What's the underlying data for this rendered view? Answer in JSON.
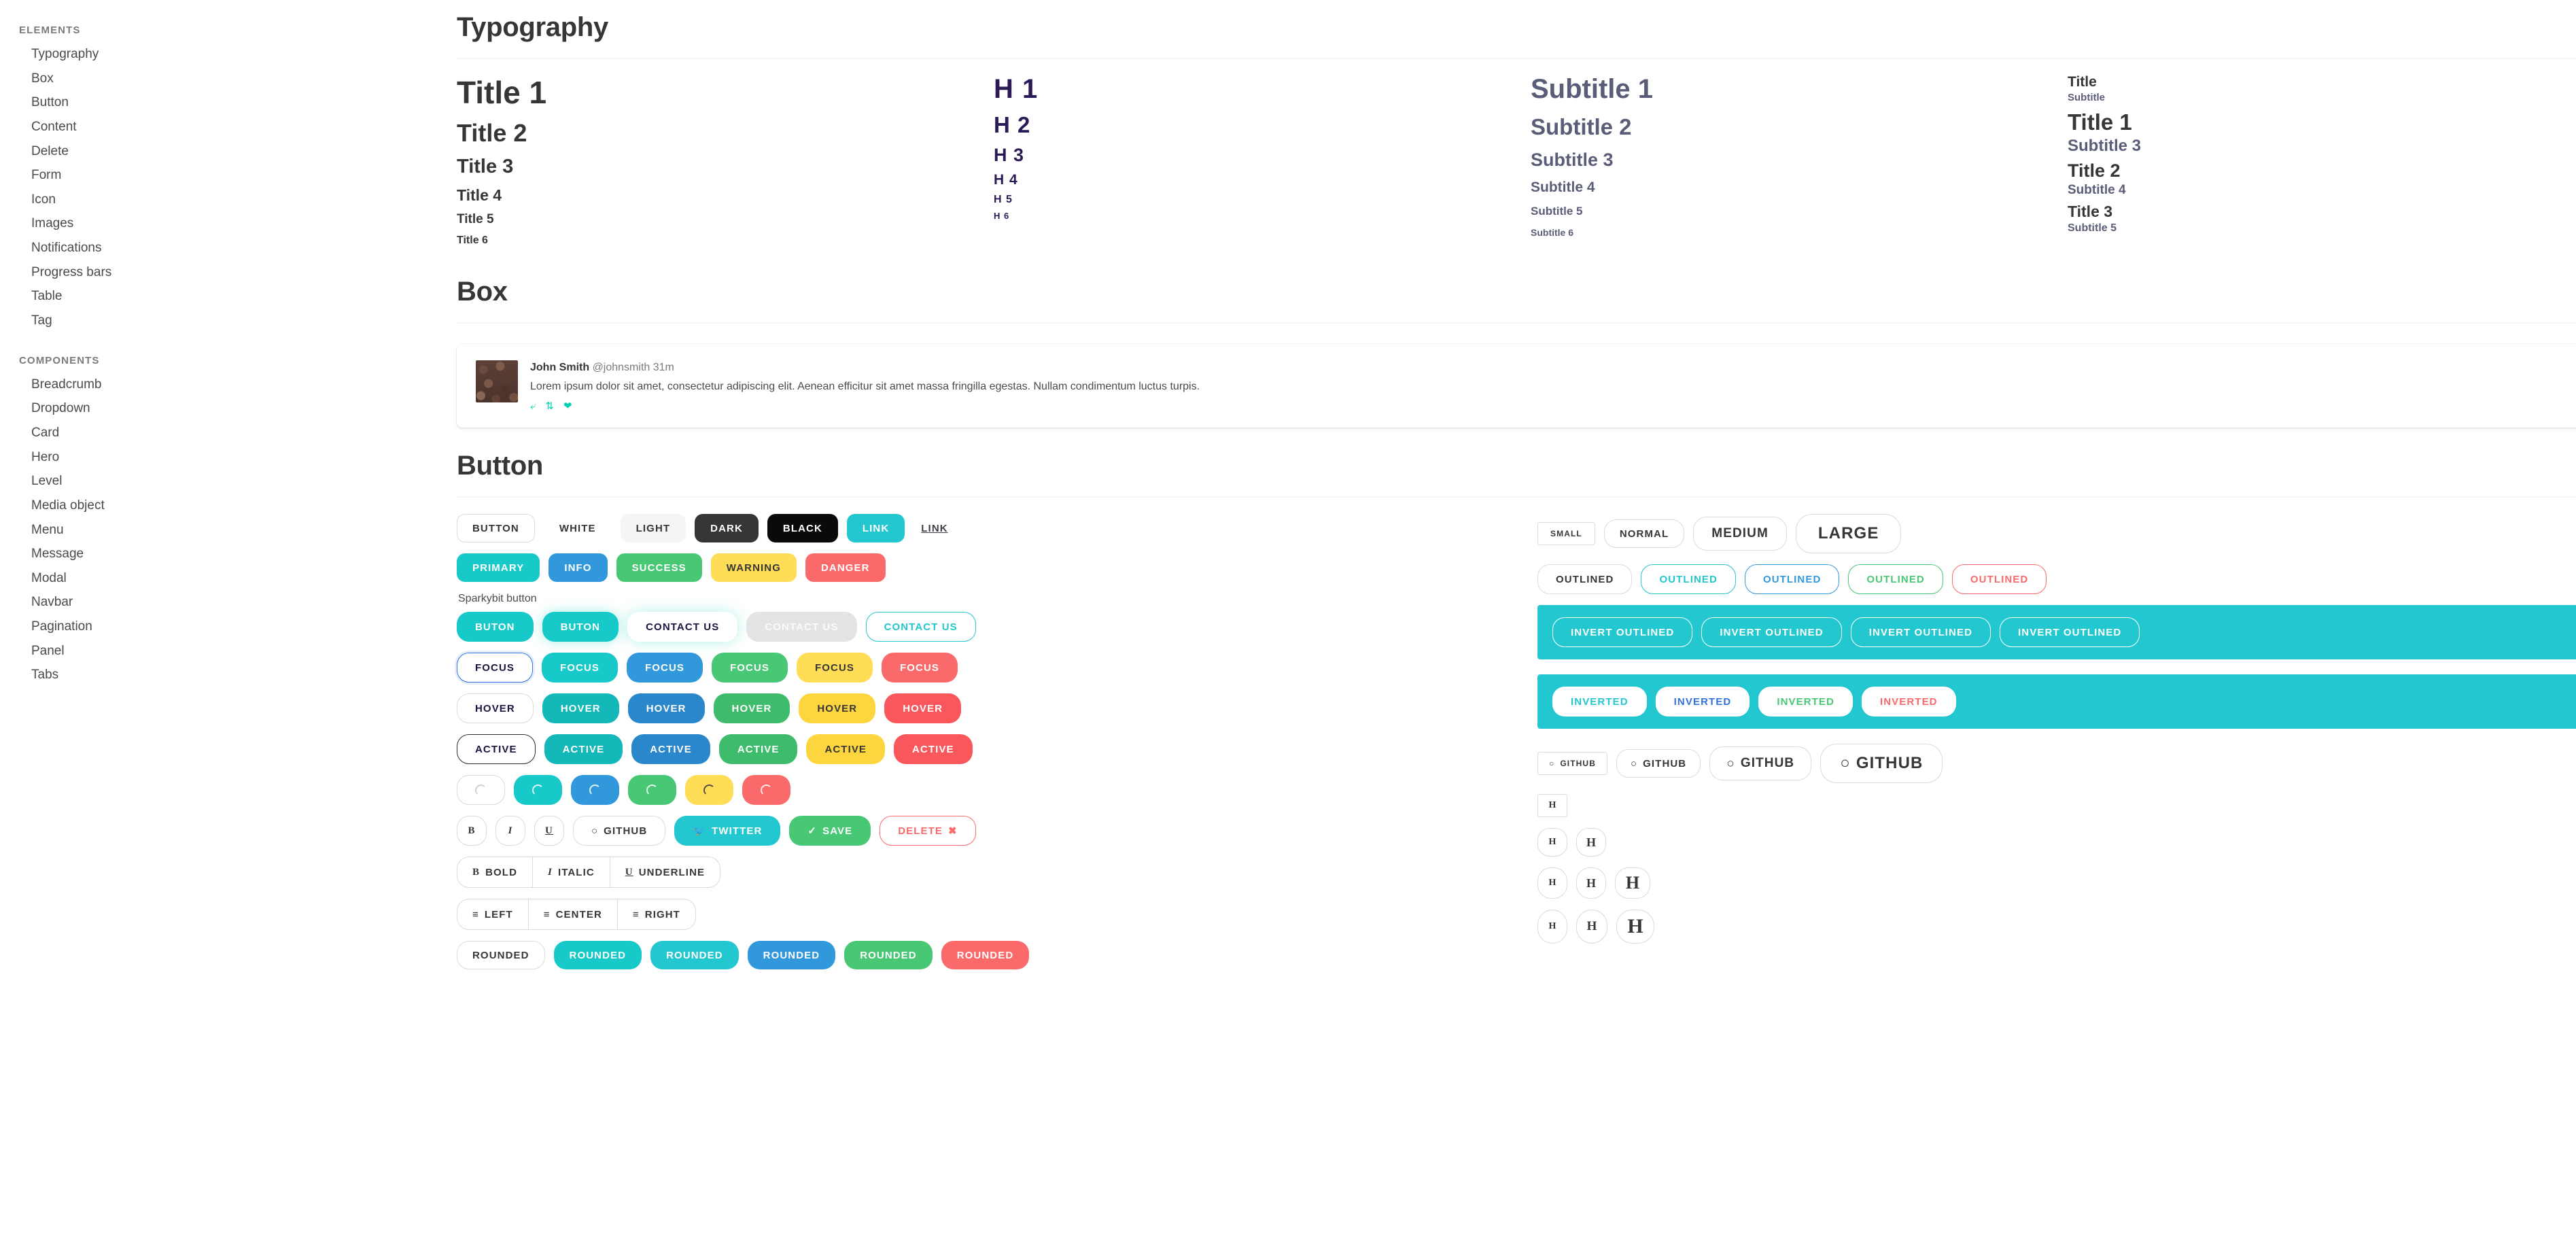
{
  "sidebar": {
    "elements_label": "ELEMENTS",
    "components_label": "COMPONENTS",
    "elements": [
      {
        "label": "Typography"
      },
      {
        "label": "Box"
      },
      {
        "label": "Button"
      },
      {
        "label": "Content"
      },
      {
        "label": "Delete"
      },
      {
        "label": "Form"
      },
      {
        "label": "Icon"
      },
      {
        "label": "Images"
      },
      {
        "label": "Notifications"
      },
      {
        "label": "Progress bars"
      },
      {
        "label": "Table"
      },
      {
        "label": "Tag"
      }
    ],
    "components": [
      {
        "label": "Breadcrumb"
      },
      {
        "label": "Dropdown"
      },
      {
        "label": "Card"
      },
      {
        "label": "Hero"
      },
      {
        "label": "Level"
      },
      {
        "label": "Media object"
      },
      {
        "label": "Menu"
      },
      {
        "label": "Message"
      },
      {
        "label": "Modal"
      },
      {
        "label": "Navbar"
      },
      {
        "label": "Pagination"
      },
      {
        "label": "Panel"
      },
      {
        "label": "Tabs"
      }
    ]
  },
  "typography": {
    "heading": "Typography",
    "titles": [
      "Title 1",
      "Title 2",
      "Title 3",
      "Title 4",
      "Title 5",
      "Title 6"
    ],
    "headings": [
      "H 1",
      "H 2",
      "H 3",
      "H 4",
      "H 5",
      "H 6"
    ],
    "subtitles": [
      "Subtitle 1",
      "Subtitle 2",
      "Subtitle 3",
      "Subtitle 4",
      "Subtitle 5",
      "Subtitle 6"
    ],
    "mixed": [
      {
        "title": "Title",
        "subtitle": "Subtitle"
      },
      {
        "title": "Title 1",
        "subtitle": "Subtitle 3"
      },
      {
        "title": "Title 2",
        "subtitle": "Subtitle 4"
      },
      {
        "title": "Title 3",
        "subtitle": "Subtitle 5"
      }
    ],
    "colors": {
      "title": "#363636",
      "heading": "#2b1a55",
      "subtitle": "#5a5d78"
    }
  },
  "box": {
    "heading": "Box",
    "author": "John Smith",
    "meta": "@johnsmith 31m",
    "text": "Lorem ipsum dolor sit amet, consectetur adipiscing elit. Aenean efficitur sit amet massa fringilla egestas. Nullam condimentum luctus turpis.",
    "actions": [
      "reply-icon",
      "retweet-icon",
      "heart-icon"
    ],
    "action_color": "#00d1b2"
  },
  "button": {
    "heading": "Button",
    "sparkybit_label": "Sparkybit button",
    "row_basic": [
      "BUTTON",
      "WHITE",
      "LIGHT",
      "DARK",
      "BLACK",
      "LINK",
      "LINK"
    ],
    "row_colors": [
      "PRIMARY",
      "INFO",
      "SUCCESS",
      "WARNING",
      "DANGER"
    ],
    "row_sparky": [
      "BUTON",
      "BUTON",
      "CONTACT US",
      "CONTACT US",
      "CONTACT US"
    ],
    "row_focus": [
      "FOCUS",
      "FOCUS",
      "FOCUS",
      "FOCUS",
      "FOCUS",
      "FOCUS"
    ],
    "row_hover": [
      "HOVER",
      "HOVER",
      "HOVER",
      "HOVER",
      "HOVER",
      "HOVER"
    ],
    "row_active": [
      "ACTIVE",
      "ACTIVE",
      "ACTIVE",
      "ACTIVE",
      "ACTIVE",
      "ACTIVE"
    ],
    "row_loading": [
      "loading-spinner",
      "loading-spinner",
      "loading-spinner",
      "loading-spinner",
      "loading-spinner",
      "loading-spinner"
    ],
    "row_icons": [
      "B",
      "I",
      "U",
      "GITHUB",
      "TWITTER",
      "SAVE",
      "DELETE"
    ],
    "row_format": [
      "BOLD",
      "ITALIC",
      "UNDERLINE"
    ],
    "row_align": [
      "LEFT",
      "CENTER",
      "RIGHT"
    ],
    "row_rounded": [
      "ROUNDED",
      "ROUNDED",
      "ROUNDED",
      "ROUNDED",
      "ROUNDED",
      "ROUNDED"
    ],
    "row_sizes": [
      "SMALL",
      "NORMAL",
      "MEDIUM",
      "LARGE"
    ],
    "row_outlined": [
      "OUTLINED",
      "OUTLINED",
      "OUTLINED",
      "OUTLINED",
      "OUTLINED"
    ],
    "row_invert_outlined": [
      "INVERT OUTLINED",
      "INVERT OUTLINED",
      "INVERT OUTLINED",
      "INVERT OUTLINED"
    ],
    "row_inverted": [
      "INVERTED",
      "INVERTED",
      "INVERTED",
      "INVERTED"
    ],
    "row_github_sizes": [
      "GITHUB",
      "GITHUB",
      "GITHUB",
      "GITHUB"
    ],
    "h_glyph": "H",
    "colors": {
      "primary": "#17c9c9",
      "info": "#3298dc",
      "success": "#48c774",
      "warning": "#ffdd57",
      "danger": "#fa6a6a",
      "link": "#22c7cf",
      "dark": "#363636",
      "black": "#0a0a0a",
      "light": "#f5f5f5",
      "panel_teal": "#22c7cf"
    }
  }
}
